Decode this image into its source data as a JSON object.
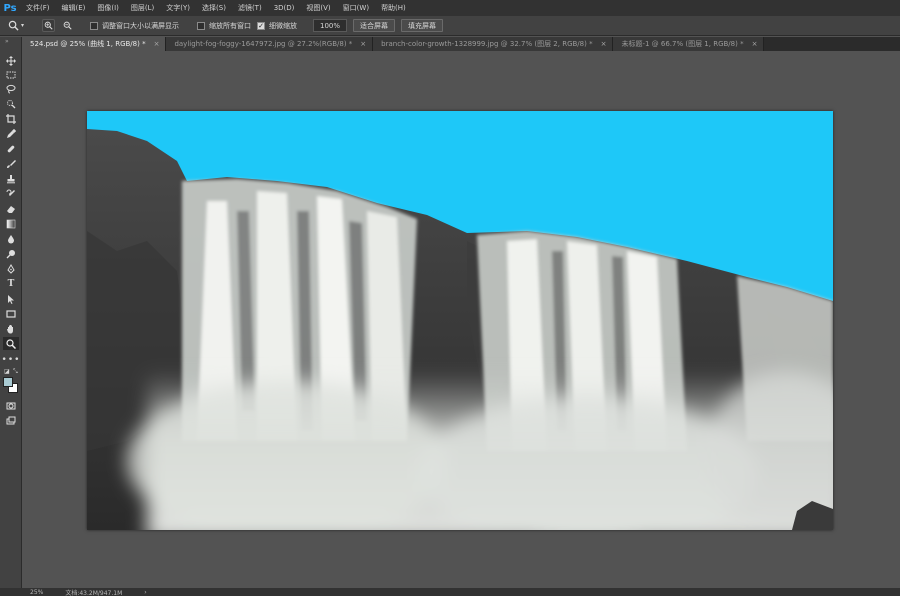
{
  "app": {
    "logo": "Ps"
  },
  "menu": [
    "文件(F)",
    "编辑(E)",
    "图像(I)",
    "图层(L)",
    "文字(Y)",
    "选择(S)",
    "滤镜(T)",
    "3D(D)",
    "视图(V)",
    "窗口(W)",
    "帮助(H)"
  ],
  "options": {
    "resize_windows": "调整窗口大小以满屏显示",
    "zoom_all": "缩放所有窗口",
    "scrubby_zoom": "细微缩放",
    "zoom_value": "100%",
    "fit_screen": "适合屏幕",
    "fill_screen": "填充屏幕"
  },
  "tabs": [
    {
      "label": "524.psd @ 25% (曲线 1, RGB/8) *",
      "close": "×"
    },
    {
      "label": "daylight-fog-foggy-1647972.jpg @ 27.2%(RGB/8) *",
      "close": "×"
    },
    {
      "label": "branch-color-growth-1328999.jpg @ 32.7% (图层 2, RGB/8) *",
      "close": "×"
    },
    {
      "label": "未标题-1 @ 66.7% (图层 1, RGB/8) *",
      "close": "×"
    }
  ],
  "status": {
    "zoom": "25%",
    "doc": "文档:43.2M/947.1M",
    "arrow": "›"
  },
  "colors": {
    "sky": "#1ec8f8",
    "accent": "#31a8ff",
    "fg_swatch": "#a9cbd3",
    "bg_swatch": "#ffffff"
  }
}
